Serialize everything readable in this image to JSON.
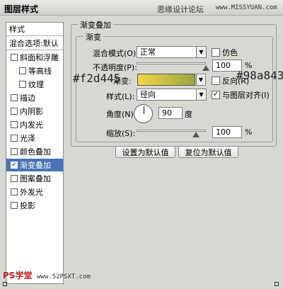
{
  "window": {
    "title": "图层样式"
  },
  "watermark": {
    "text": "思缘设计论坛",
    "url": "www.MISSYUAN.com"
  },
  "sidebar": {
    "items": [
      {
        "label": "样式",
        "checkbox": false,
        "checked": false
      },
      {
        "label": "混合选项:默认",
        "checkbox": false,
        "checked": false
      },
      {
        "label": "斜面和浮雕",
        "checkbox": true,
        "checked": false
      },
      {
        "label": "等高线",
        "checkbox": true,
        "checked": false
      },
      {
        "label": "纹理",
        "checkbox": true,
        "checked": false
      },
      {
        "label": "描边",
        "checkbox": true,
        "checked": false
      },
      {
        "label": "内阴影",
        "checkbox": true,
        "checked": false
      },
      {
        "label": "内发光",
        "checkbox": true,
        "checked": false
      },
      {
        "label": "光泽",
        "checkbox": true,
        "checked": false
      },
      {
        "label": "颜色叠加",
        "checkbox": true,
        "checked": false
      },
      {
        "label": "渐变叠加",
        "checkbox": true,
        "checked": true
      },
      {
        "label": "图案叠加",
        "checkbox": true,
        "checked": false
      },
      {
        "label": "外发光",
        "checkbox": true,
        "checked": false
      },
      {
        "label": "投影",
        "checkbox": true,
        "checked": false
      }
    ]
  },
  "panel": {
    "title": "渐变叠加",
    "subtitle": "渐变",
    "blend_mode_label": "混合模式(O):",
    "blend_mode_value": "正常",
    "dither_label": "仿色",
    "opacity_label": "不透明度(P):",
    "opacity_value": "100",
    "opacity_unit": "%",
    "gradient_label": "渐变:",
    "gradient_colors": [
      "#f2d445",
      "#98a843"
    ],
    "reverse_label": "反向(R)",
    "style_label": "样式(L):",
    "style_value": "径向",
    "align_label": "与图层对齐(I)",
    "angle_label": "角度(N):",
    "angle_value": "90",
    "angle_unit": "度",
    "scale_label": "缩放(S):",
    "scale_value": "100",
    "scale_unit": "%",
    "make_default": "设置为默认值",
    "reset_default": "复位为默认值"
  },
  "annotations": {
    "left_color": "#f2d445",
    "right_color": "#98a843"
  },
  "footer": {
    "logo": "PS学堂",
    "url": "www.52PSXT.com"
  }
}
